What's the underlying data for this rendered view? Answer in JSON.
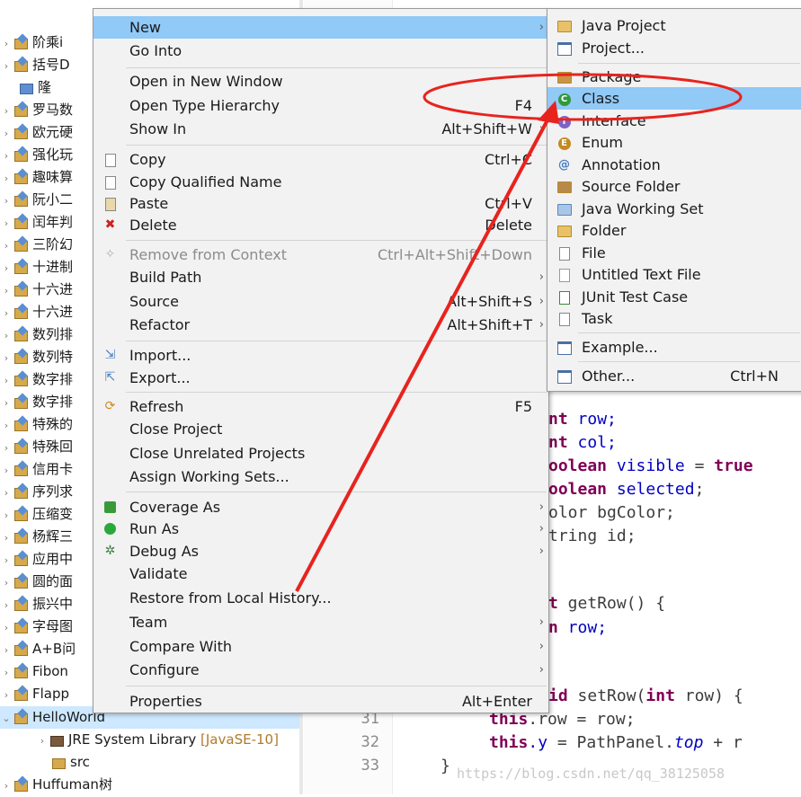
{
  "explorer": {
    "rows": [
      {
        "label": "阶乘i",
        "type": "project"
      },
      {
        "label": "括号D",
        "type": "project"
      },
      {
        "label": "隆",
        "type": "folder"
      },
      {
        "label": "罗马数",
        "type": "project"
      },
      {
        "label": "欧元硬",
        "type": "project"
      },
      {
        "label": "强化玩",
        "type": "project"
      },
      {
        "label": "趣味算",
        "type": "project"
      },
      {
        "label": "阮小二",
        "type": "project"
      },
      {
        "label": "闰年判",
        "type": "project"
      },
      {
        "label": "三阶幻",
        "type": "project"
      },
      {
        "label": "十进制",
        "type": "project"
      },
      {
        "label": "十六进",
        "type": "project"
      },
      {
        "label": "十六进",
        "type": "project"
      },
      {
        "label": "数列排",
        "type": "project"
      },
      {
        "label": "数列特",
        "type": "project"
      },
      {
        "label": "数字排",
        "type": "project"
      },
      {
        "label": "特殊的",
        "type": "project"
      },
      {
        "label": "特殊回",
        "type": "project"
      },
      {
        "label": "信用卡",
        "type": "project"
      },
      {
        "label": "序列求",
        "type": "project"
      },
      {
        "label": "压缩变",
        "type": "project"
      },
      {
        "label": "杨辉三",
        "type": "project"
      },
      {
        "label": "应用中",
        "type": "project"
      },
      {
        "label": "圆的面",
        "type": "project"
      },
      {
        "label": "振兴中",
        "type": "project"
      },
      {
        "label": "字母图",
        "type": "project"
      },
      {
        "label": "A+B问",
        "type": "project"
      },
      {
        "label": "Fibon",
        "type": "project"
      },
      {
        "label": "Flapp",
        "type": "project"
      }
    ],
    "selected_project": "HelloWorld",
    "jre_label": "JRE System Library",
    "jre_version": "[JavaSE-10]",
    "src_label": "src",
    "last_project": "Huffuman树"
  },
  "editor": {
    "line_numbers": [
      "31",
      "32",
      "33"
    ],
    "code": {
      "l1_kw": "nt",
      "l1_rest": " row;",
      "l2_kw": "nt",
      "l2_rest": " col;",
      "l3_kw": "oolean",
      "l3_fld": " visible",
      "l3_rest": " = ",
      "l3_true": "true",
      "l4_kw": "oolean",
      "l4_fld": " selected",
      "l4_rest": ";",
      "l5_text": "olor bgColor;",
      "l6_text": "tring id;",
      "l7_kw": "t",
      "l7_rest": " getRow() {",
      "l8_kw": "n",
      "l8_rest": " row;",
      "l9_kw": "id",
      "l9_rest": " setRow(",
      "l9_kw2": "int",
      "l9_rest2": " row) {",
      "l10_kw": "this",
      "l10_rest": ".row = row;",
      "l11_kw": "this",
      "l11_fld": ".y",
      "l11_rest": " = PathPanel.",
      "l11_it": "top",
      "l11_rest2": " + r",
      "l12": "}"
    },
    "watermark": "https://blog.csdn.net/qq_38125058"
  },
  "context_menu": {
    "items": [
      {
        "label": "New",
        "accel": "",
        "submenu": true,
        "highlight": true
      },
      {
        "label": "Go Into",
        "accel": ""
      },
      {
        "label": "Open in New Window",
        "accel": ""
      },
      {
        "label": "Open Type Hierarchy",
        "accel": "F4"
      },
      {
        "label": "Show In",
        "accel": "Alt+Shift+W",
        "submenu": true
      },
      {
        "label": "Copy",
        "accel": "Ctrl+C"
      },
      {
        "label": "Copy Qualified Name",
        "accel": ""
      },
      {
        "label": "Paste",
        "accel": "Ctrl+V"
      },
      {
        "label": "Delete",
        "accel": "Delete"
      },
      {
        "label": "Remove from Context",
        "accel": "Ctrl+Alt+Shift+Down",
        "disabled": true
      },
      {
        "label": "Build Path",
        "accel": "",
        "submenu": true
      },
      {
        "label": "Source",
        "accel": "Alt+Shift+S",
        "submenu": true
      },
      {
        "label": "Refactor",
        "accel": "Alt+Shift+T",
        "submenu": true
      },
      {
        "label": "Import...",
        "accel": ""
      },
      {
        "label": "Export...",
        "accel": ""
      },
      {
        "label": "Refresh",
        "accel": "F5"
      },
      {
        "label": "Close Project",
        "accel": ""
      },
      {
        "label": "Close Unrelated Projects",
        "accel": ""
      },
      {
        "label": "Assign Working Sets...",
        "accel": ""
      },
      {
        "label": "Coverage As",
        "accel": "",
        "submenu": true
      },
      {
        "label": "Run As",
        "accel": "",
        "submenu": true
      },
      {
        "label": "Debug As",
        "accel": "",
        "submenu": true
      },
      {
        "label": "Validate",
        "accel": ""
      },
      {
        "label": "Restore from Local History...",
        "accel": ""
      },
      {
        "label": "Team",
        "accel": "",
        "submenu": true
      },
      {
        "label": "Compare With",
        "accel": "",
        "submenu": true
      },
      {
        "label": "Configure",
        "accel": "",
        "submenu": true
      },
      {
        "label": "Properties",
        "accel": "Alt+Enter"
      }
    ]
  },
  "new_submenu": {
    "items": [
      {
        "label": "Java Project",
        "accel": ""
      },
      {
        "label": "Project...",
        "accel": ""
      },
      {
        "label": "Package",
        "accel": ""
      },
      {
        "label": "Class",
        "accel": "",
        "highlight": true
      },
      {
        "label": "Interface",
        "accel": ""
      },
      {
        "label": "Enum",
        "accel": ""
      },
      {
        "label": "Annotation",
        "accel": ""
      },
      {
        "label": "Source Folder",
        "accel": ""
      },
      {
        "label": "Java Working Set",
        "accel": ""
      },
      {
        "label": "Folder",
        "accel": ""
      },
      {
        "label": "File",
        "accel": ""
      },
      {
        "label": "Untitled Text File",
        "accel": ""
      },
      {
        "label": "JUnit Test Case",
        "accel": ""
      },
      {
        "label": "Task",
        "accel": ""
      },
      {
        "label": "Example...",
        "accel": ""
      },
      {
        "label": "Other...",
        "accel": "Ctrl+N"
      }
    ]
  },
  "annotation": {
    "color": "#e8231e"
  }
}
